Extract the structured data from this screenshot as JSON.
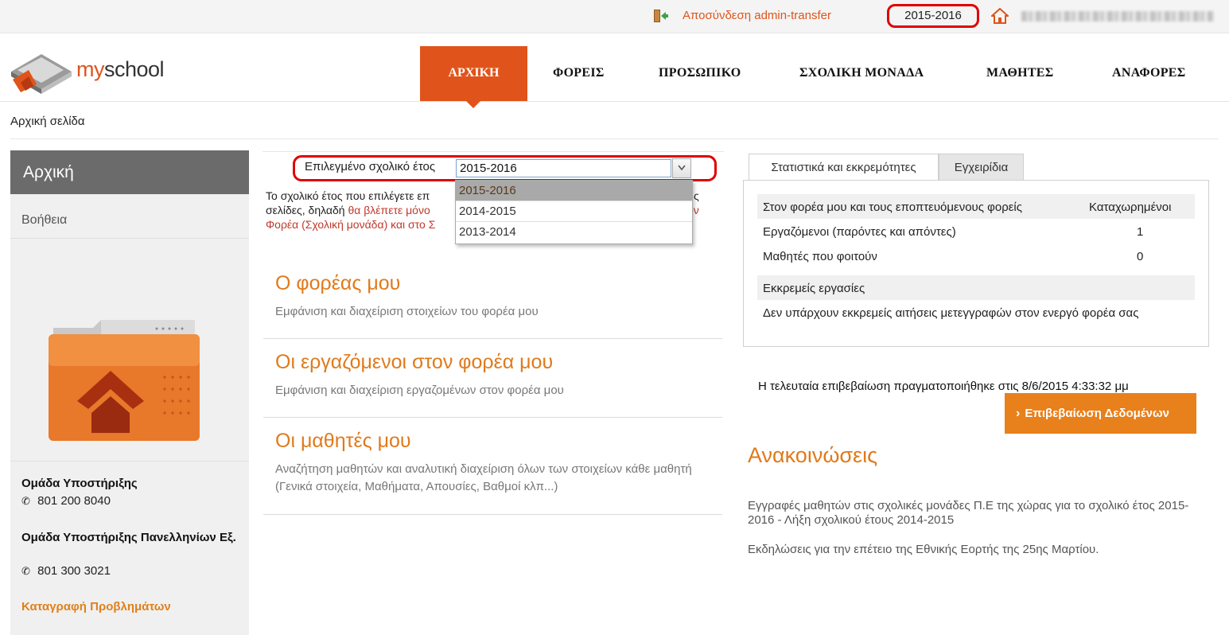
{
  "topbar": {
    "logout_label": "Αποσύνδεση admin-transfer",
    "current_year": "2015-2016"
  },
  "header": {
    "logo_my": "my",
    "logo_school": "school",
    "nav": [
      {
        "label": "ΑΡΧΙΚΗ",
        "active": true
      },
      {
        "label": "ΦΟΡΕΙΣ"
      },
      {
        "label": "ΠΡΟΣΩΠΙΚΟ"
      },
      {
        "label": "ΣΧΟΛΙΚΗ ΜΟΝΑΔΑ"
      },
      {
        "label": "ΜΑΘΗΤΕΣ"
      },
      {
        "label": "ΑΝΑΦΟΡΕΣ"
      }
    ]
  },
  "breadcrumb": "Αρχική σελίδα",
  "sidebar": {
    "title": "Αρχική",
    "help": "Βοήθεια",
    "support_team": "Ομάδα Υποστήριξης",
    "support_phone": "801 200 8040",
    "panhellenic_team": "Ομάδα Υποστήριξης Πανελληνίων Εξ.",
    "panhellenic_phone": "801 300 3021",
    "problems_link": "Καταγραφή Προβλημάτων"
  },
  "year_selector": {
    "label": "Επιλεγμένο σχολικό έτος",
    "value": "2015-2016",
    "options": [
      "2015-2016",
      "2014-2015",
      "2013-2014"
    ],
    "selected_index": 0
  },
  "info": {
    "line1_visible": "Το σχολικό έτος που επιλέγετε επ",
    "line1_tail": "ς",
    "line2_prefix": "σελίδες, δηλαδή ",
    "line2_highlight": "θα βλέπετε μόνο",
    "line2_tail": "ον",
    "line3_highlight": "Φορέα (Σχολική μονάδα) και στο Σ"
  },
  "sections": [
    {
      "title": "Ο φορέας μου",
      "description": "Εμφάνιση και διαχείριση στοιχείων του φορέα μου"
    },
    {
      "title": "Οι εργαζόμενοι στον φορέα μου",
      "description": "Εμφάνιση και διαχείριση εργαζομένων στον φορέα μου"
    },
    {
      "title": "Οι μαθητές μου",
      "description": "Αναζήτηση μαθητών και αναλυτική διαχείριση όλων των στοιχείων κάθε μαθητή (Γενικά στοιχεία, Μαθήματα, Απουσίες, Βαθμοί κλπ...)"
    }
  ],
  "tabs": [
    "Στατιστικά και εκκρεμότητες",
    "Εγχειρίδια"
  ],
  "stats": {
    "header_label": "Στον φορέα μου και τους εποπτευόμενους φορείς",
    "header_value": "Καταχωρημένοι",
    "rows": [
      {
        "label": "Εργαζόμενοι (παρόντες και απόντες)",
        "value": "1"
      },
      {
        "label": "Μαθητές που φοιτούν",
        "value": "0"
      }
    ],
    "pending_title": "Εκκρεμείς εργασίες",
    "pending_text": "Δεν υπάρχουν εκκρεμείς αιτήσεις μετεγγραφών στον ενεργό φορέα σας"
  },
  "confirmation": {
    "last_text": "Η τελευταία επιβεβαίωση πραγματοποιήθηκε στις 8/6/2015 4:33:32 μμ",
    "button_label": "Επιβεβαίωση Δεδομένων"
  },
  "announcements": {
    "title": "Ανακοινώσεις",
    "items": [
      "Εγγραφές μαθητών στις σχολικές μονάδες Π.Ε της χώρας για το σχολικό έτος 2015-2016 - Λήξη σχολικού έτους 2014-2015",
      "Εκδηλώσεις για την επέτειο της Εθνικής Εορτής της 25ης Μαρτίου."
    ]
  },
  "colors": {
    "brand_orange": "#e0541b",
    "accent_orange": "#e8801b",
    "highlight_red": "#e00000"
  }
}
